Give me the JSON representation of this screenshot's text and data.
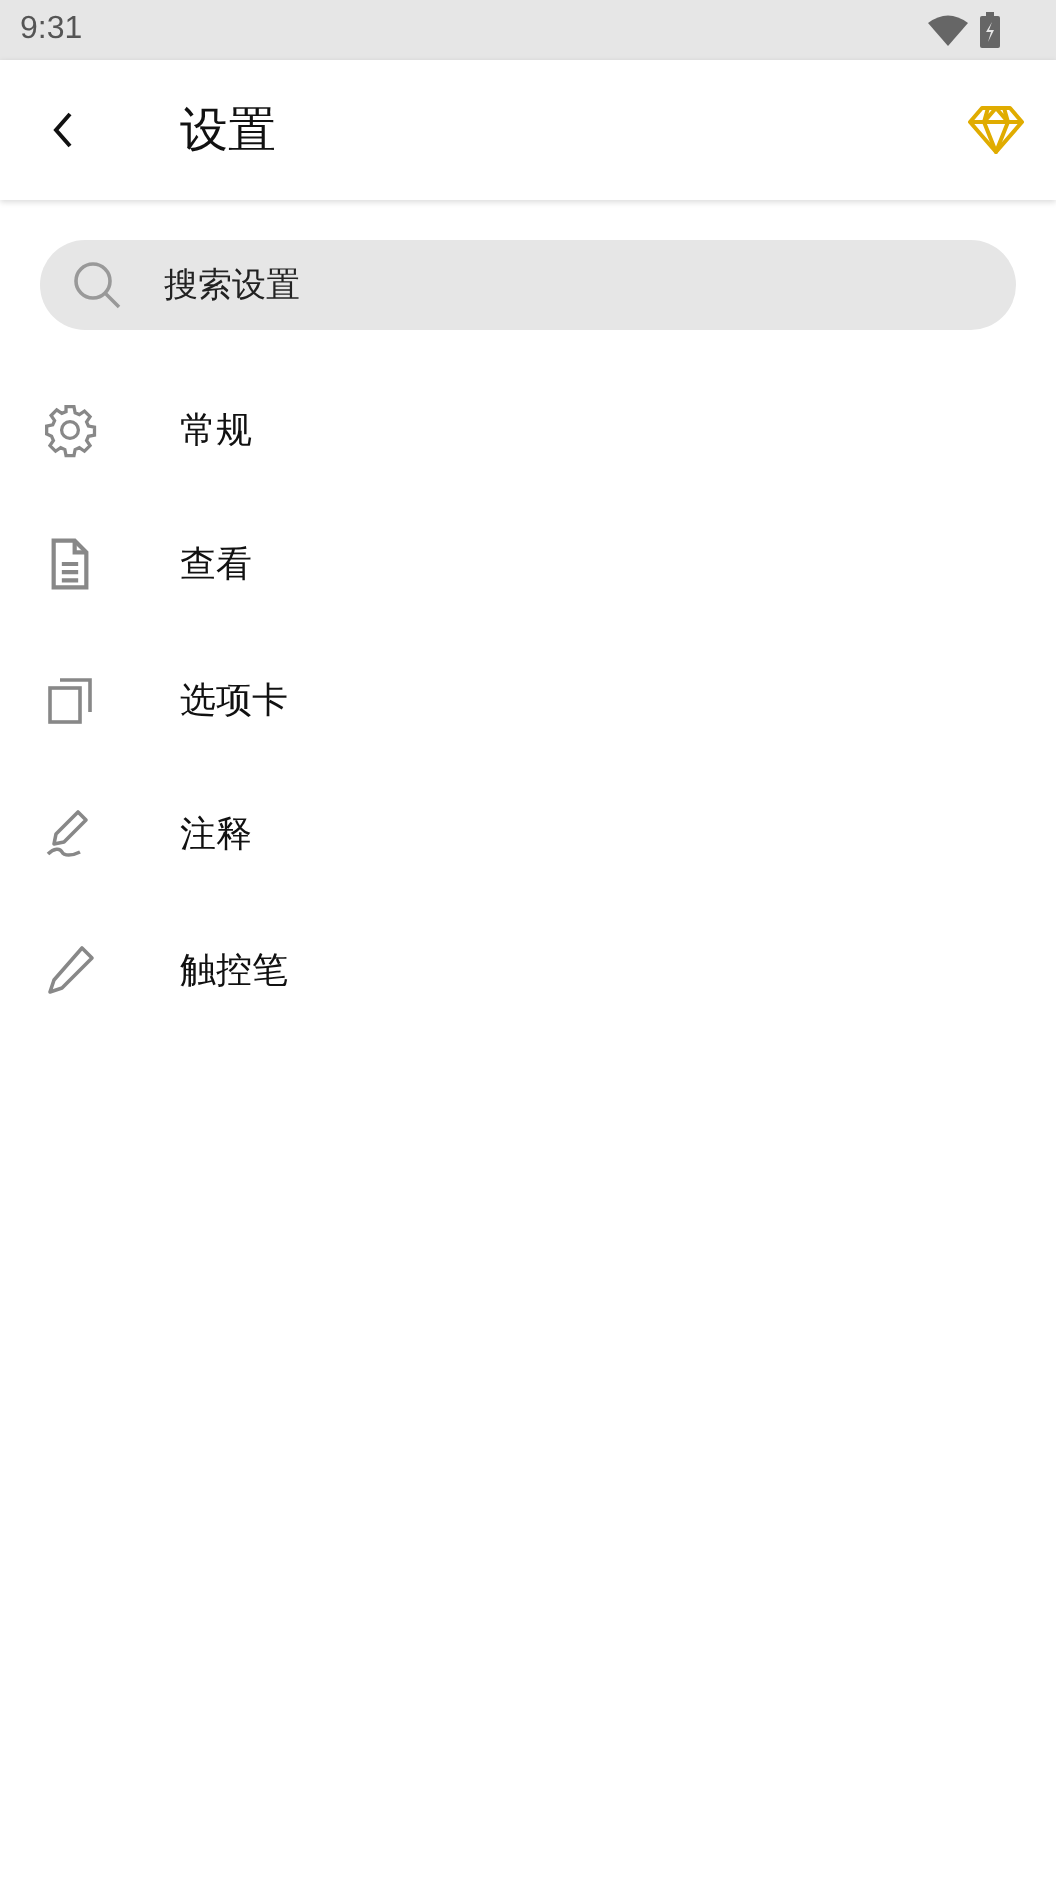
{
  "status_bar": {
    "time": "9:31"
  },
  "header": {
    "title": "设置"
  },
  "search": {
    "placeholder": "搜索设置"
  },
  "menu_items": [
    {
      "label": "常规"
    },
    {
      "label": "查看"
    },
    {
      "label": "选项卡"
    },
    {
      "label": "注释"
    },
    {
      "label": "触控笔"
    }
  ]
}
